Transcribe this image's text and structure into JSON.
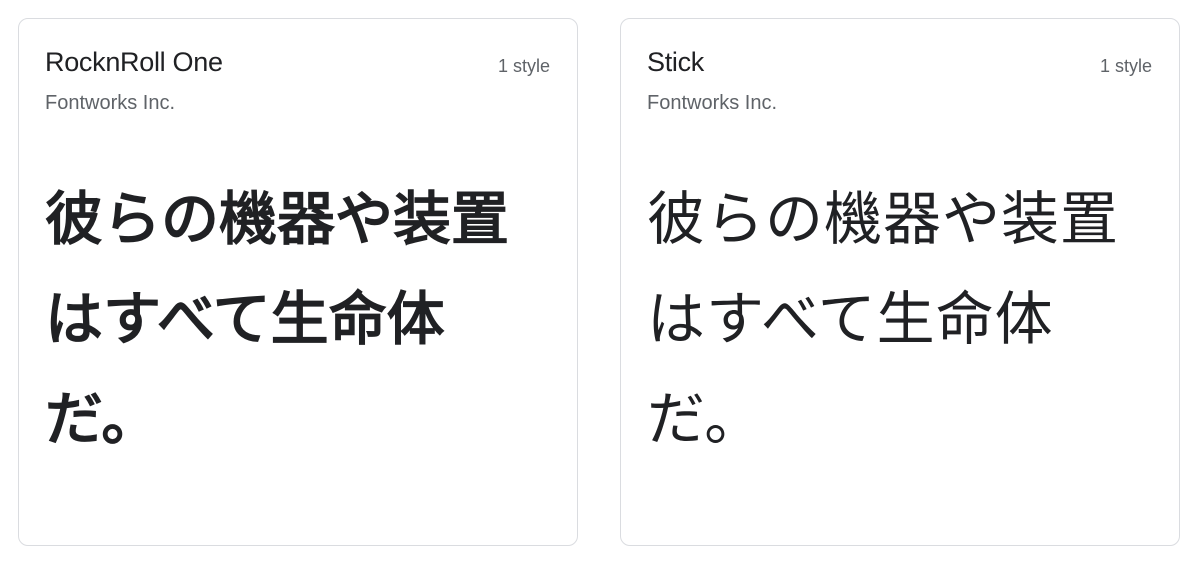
{
  "cards": [
    {
      "family": "RocknRoll One",
      "styles": "1 style",
      "foundry": "Fontworks Inc.",
      "preview": "彼らの機器や装置はすべて生命体だ。"
    },
    {
      "family": "Stick",
      "styles": "1 style",
      "foundry": "Fontworks Inc.",
      "preview": "彼らの機器や装置はすべて生命体だ。"
    }
  ]
}
